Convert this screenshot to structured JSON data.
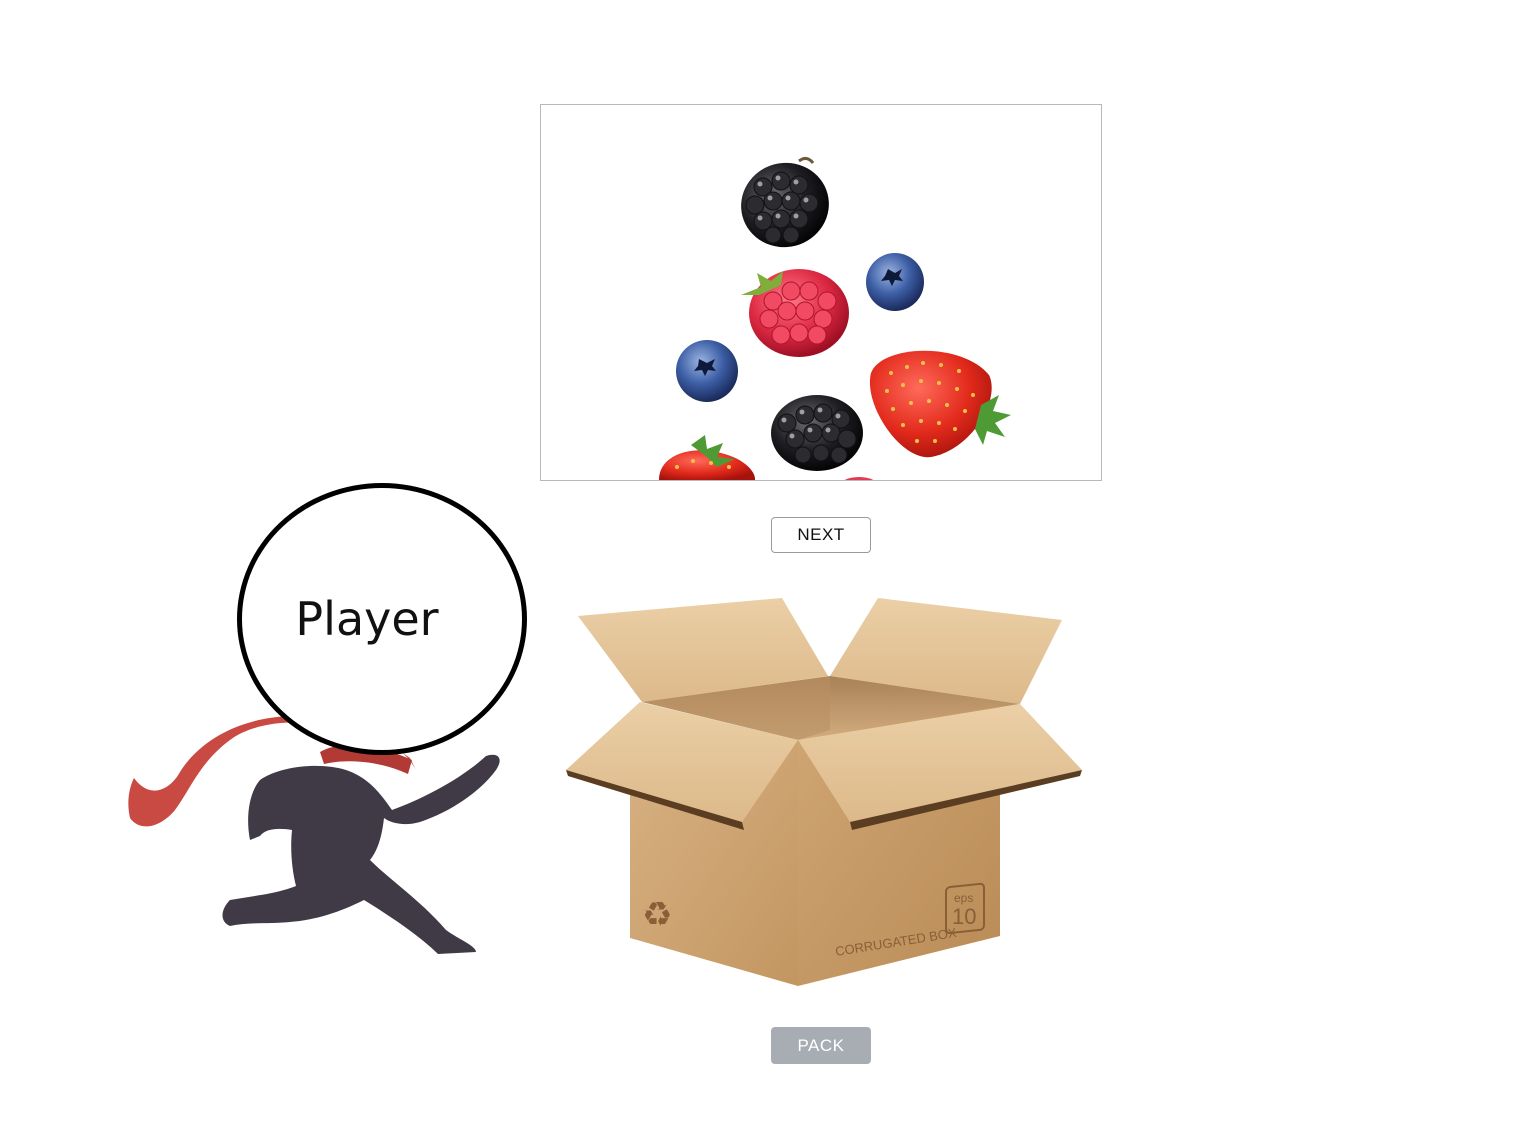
{
  "buttons": {
    "next_label": "NEXT",
    "pack_label": "PACK"
  },
  "player": {
    "label": "Player"
  },
  "box": {
    "label": "CORRUGATED BOX",
    "badge_top": "eps",
    "badge_bottom": "10",
    "recycle_symbol": "♻"
  },
  "colors": {
    "box_brown": "#c9a06b",
    "scarf_red": "#c94a43",
    "runner_dark": "#3f3a45",
    "pack_button": "#a7adb3"
  },
  "icons": {
    "fruit_image": "mixed-berries-image",
    "runner": "running-person-illustration",
    "box": "open-cardboard-box-illustration"
  }
}
